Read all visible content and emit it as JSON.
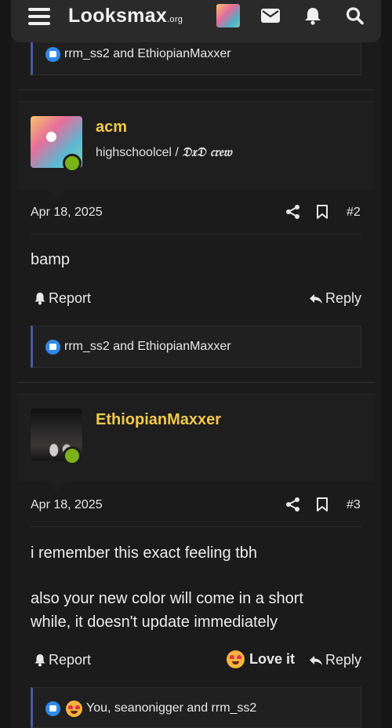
{
  "header": {
    "logo_main": "Looksmax",
    "logo_suffix": ".org",
    "icons": [
      "menu-icon",
      "user-avatar",
      "mail-icon",
      "bell-icon",
      "search-icon"
    ]
  },
  "top_reactions": {
    "text": "rrm_ss2 and EthiopianMaxxer"
  },
  "posts": [
    {
      "username": "acm",
      "user_title_plain": "highschoolcel / ",
      "user_title_styled": "𝔇𝔵𝔇 𝔠𝔯𝔢𝔴",
      "date": "Apr 18, 2025",
      "number": "#2",
      "body": "bamp",
      "report_label": "Report",
      "reply_label": "Reply",
      "reactions_text": "rrm_ss2 and EthiopianMaxxer"
    },
    {
      "username": "EthiopianMaxxer",
      "date": "Apr 18, 2025",
      "number": "#3",
      "body_line1": "i remember this exact feeling tbh",
      "body_line2": "also your new color will come in a short",
      "body_line3": "while, it doesn't update immediately",
      "report_label": "Report",
      "loveit_label": "Love it",
      "reply_label": "Reply",
      "reactions_text": "You, seanonigger and rrm_ss2"
    }
  ],
  "colors": {
    "username": "#f2c94c",
    "online": "#7ab317",
    "like": "#2f89e8",
    "reaction_border": "#4a5aa8"
  }
}
